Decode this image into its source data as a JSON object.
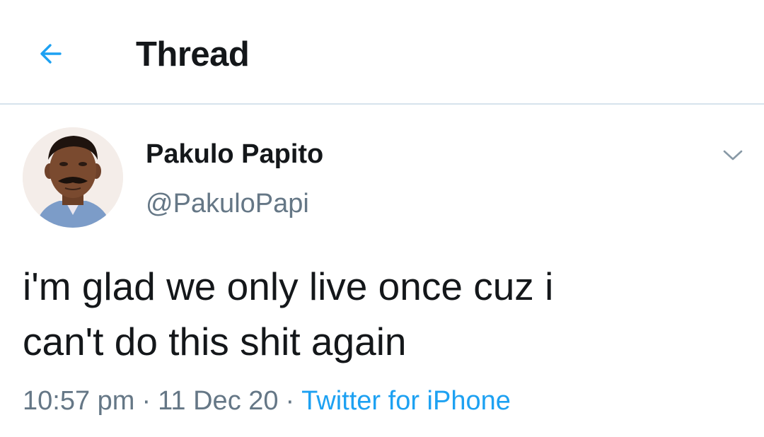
{
  "header": {
    "title": "Thread",
    "back_icon": "arrow-left-icon"
  },
  "tweet": {
    "author": {
      "name": "Pakulo Papito",
      "handle": "@PakuloPapi"
    },
    "text": "i'm glad we only live once cuz i\ncan't do this shit again",
    "time": "10:57 pm",
    "date": "11 Dec 20",
    "separator": "·",
    "source": "Twitter for iPhone"
  },
  "colors": {
    "accent": "#1da1f2",
    "text_primary": "#14171a",
    "text_secondary": "#657786",
    "divider": "#d6e3ec"
  }
}
